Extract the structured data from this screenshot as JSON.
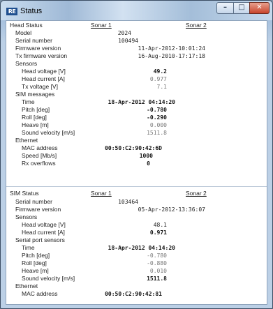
{
  "window": {
    "title": "Status",
    "icon_text": "RE",
    "min_glyph": "–",
    "max_glyph": "□",
    "close_glyph": "✕"
  },
  "head_status": {
    "label": "Head Status",
    "col1": "Sonar 1",
    "col2": "Sonar 2",
    "model_label": "Model",
    "model_value": "2024",
    "serial_label": "Serial number",
    "serial_value": "100494",
    "fw_label": "Firmware version",
    "fw_value": "11-Apr-2012-10:01:24",
    "txfw_label": "Tx firmware version",
    "txfw_value": "16-Aug-2010-17:17:18",
    "sensors_label": "Sensors",
    "head_voltage_label": "Head voltage [V]",
    "head_voltage_value": "49.2",
    "head_current_label": "Head current [A]",
    "head_current_value": "0.977",
    "tx_voltage_label": "Tx voltage [V]",
    "tx_voltage_value": "7.1",
    "sim_messages_label": "SIM messages",
    "time_label": "Time",
    "time_value": "18-Apr-2012 04:14:20",
    "pitch_label": "Pitch [deg]",
    "pitch_value": "-0.780",
    "roll_label": "Roll [deg]",
    "roll_value": "-0.290",
    "heave_label": "Heave [m]",
    "heave_value": "0.000",
    "sv_label": "Sound velocity [m/s]",
    "sv_value": "1511.8",
    "ethernet_label": "Ethernet",
    "mac_label": "MAC address",
    "mac_value": "00:50:C2:90:42:6D",
    "speed_label": "Speed [Mb/s]",
    "speed_value": "1000",
    "rxoverflows_label": "Rx overflows",
    "rxoverflows_value": "0"
  },
  "sim_status": {
    "label": "SIM Status",
    "col1": "Sonar 1",
    "col2": "Sonar 2",
    "serial_label": "Serial number",
    "serial_value": "103464",
    "fw_label": "Firmware version",
    "fw_value": "05-Apr-2012-13:36:07",
    "sensors_label": "Sensors",
    "head_voltage_label": "Head voltage [V]",
    "head_voltage_value": "48.1",
    "head_current_label": "Head current [A]",
    "head_current_value": "0.971",
    "serial_port_label": "Serial port sensors",
    "time_label": "Time",
    "time_value": "18-Apr-2012 04:14:20",
    "pitch_label": "Pitch [deg]",
    "pitch_value": "-0.780",
    "roll_label": "Roll [deg]",
    "roll_value": "-0.880",
    "heave_label": "Heave [m]",
    "heave_value": "0.010",
    "sv_label": "Sound velocity [m/s]",
    "sv_value": "1511.8",
    "ethernet_label": "Ethernet",
    "mac_label": "MAC address",
    "mac_value": "00:50:C2:90:42:81"
  }
}
